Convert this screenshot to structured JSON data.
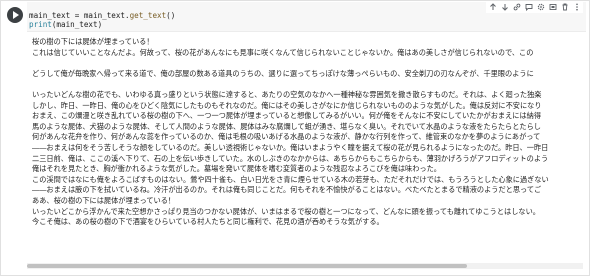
{
  "cell": {
    "code_lines": [
      "main_text = main_text.get_text()",
      "print(main_text)"
    ],
    "toolbar": [
      {
        "name": "move-cell-up-icon",
        "glyph": "↑"
      },
      {
        "name": "move-cell-down-icon",
        "glyph": "↓"
      },
      {
        "name": "link-icon",
        "glyph": "🔗"
      },
      {
        "name": "comment-icon",
        "glyph": "▭"
      },
      {
        "name": "settings-icon",
        "glyph": "⚙"
      },
      {
        "name": "mirror-cell-icon",
        "glyph": "▣"
      },
      {
        "name": "delete-icon",
        "glyph": "🗑"
      },
      {
        "name": "more-options-icon",
        "glyph": "⋮"
      }
    ]
  },
  "output": {
    "lines": [
      "桜の樹の下には屍体が埋まっている！",
      "これは信じていいことなんだよ。何故って、桜の花があんなにも見事に咲くなんて信じられないことじゃないか。俺はあの美しさが信じられないので、この",
      "",
      "どうして俺が毎晩家へ帰って来る道で、俺の部屋の数ある道具のうちの、選りに選ってちっぽけな薄っぺらいもの、安全剃刀の刃なんぞが、千里眼のように",
      "",
      "いったいどんな樹の花でも、いわゆる真っ盛りという状態に達すると、あたりの空気のなかへ一種神秘な雰囲気を撒き散らすものだ。それは、よく廻った独楽",
      "しかし、昨日、一昨日、俺の心をひどく陰気にしたものもそれなのだ。俺にはその美しさがなにか信じられないもののような気がした。俺は反対に不安になり",
      "おまえ、この爛漫と咲き乱れている桜の樹の下へ、一つ一つ屍体が埋まっていると想像してみるがいい。何が俺をそんなに不安にしていたかがおまえには納得",
      "馬のような屍体、犬猫のような屍体、そして人間のような屍体、屍体はみな腐爛して蛆が湧き、堪らなく臭い。それでいて水晶のような液をたらたらとたらし",
      "何があんな花弁を作り、何があんな蕊を作っているのか、俺は毛根の吸いあげる水晶のような液が、静かな行列を作って、維管束のなかを夢のようにあがって",
      "――おまえは何をそう苦しそうな顔をしているのだ。美しい透視術じゃないか。俺はいまようやく瞳を据えて桜の花が見られるようになったのだ。昨日、一昨日",
      "二三日前、俺は、ここの溪へ下りて、石の上を伝い歩きしていた。水のしぶきのなかからは、あちらからもこちらからも、薄羽かげろうがアフロディットのよう",
      "俺はそれを見たとき、胸が衝かれるような気がした。墓場を発いて屍体を嗜む変質者のような残忍なよろこびを俺は味わった。",
      "この渓間ではなにも俺をよろこばすものはない。鶯や四十雀も、白い日光をさ青に煙らせている木の若芽も、ただそれだけでは、もうろうとした心象に過ぎない",
      "――おまえは腋の下を拭いているね。冷汗が出るのか。それは俺も同じことだ。何もそれを不愉快がることはない。べたべたとまるで精液のようだと思ってご",
      "ああ、桜の樹の下には屍体が埋まっている！",
      "いったいどこから浮かんで来た空想かさっぱり見当のつかない屍体が、いまはまるで桜の樹と一つになって、どんなに頭を振っても離れてゆこうとはしない。",
      "今こそ俺は、あの桜の樹の下で酒宴をひらいている村人たちと同じ権利で、花見の酒が呑めそうな気がする。"
    ]
  }
}
